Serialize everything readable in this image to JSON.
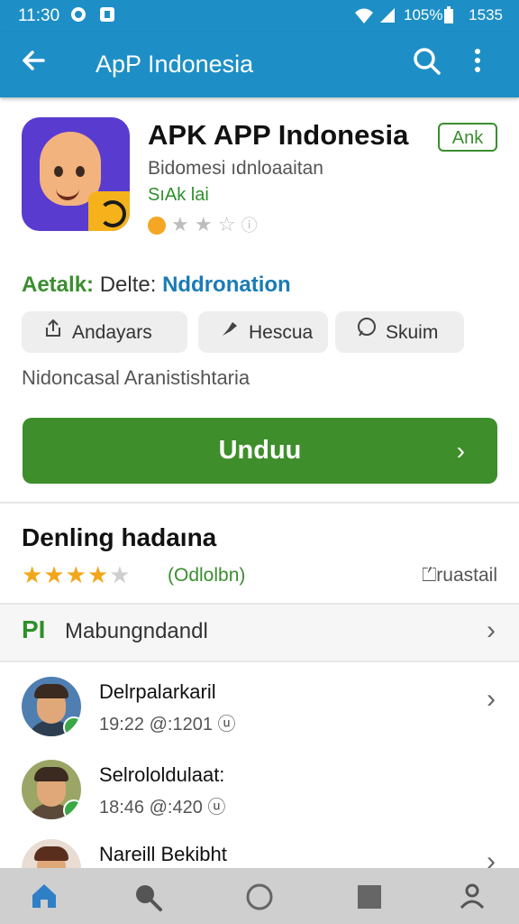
{
  "status_bar": {
    "time": "11:30",
    "battery": "105%",
    "clock_right": "1535"
  },
  "app_bar": {
    "title": "ApP Indonesia"
  },
  "app": {
    "title": "APK APP Indonesia",
    "install_chip": "Ank",
    "subtitle": "Bidomesi ıdnloaaitan",
    "developer": "SıAk lai",
    "meta_key": "Aetalk:",
    "meta_mid": " Delte: ",
    "meta_value": "Nddronation",
    "chips": [
      {
        "label": "Andayars",
        "icon": "share-icon"
      },
      {
        "label": "Hescua",
        "icon": "pin-icon"
      },
      {
        "label": "Skuim",
        "icon": "chat-icon"
      }
    ],
    "category": "Nidoncasal Aranistishtaria",
    "download_label": "Unduu",
    "download_chevron": "›"
  },
  "reviews_section": {
    "title": "Denling hadaına",
    "rating_stars": 4,
    "rating_count": "(Odlolbn)",
    "right_label": "ruastail",
    "row_logo": "PI",
    "row_label": "Mabungndandl",
    "items": [
      {
        "name": "Delrpalarkaril",
        "time": "19:22 @:1201 ⓤ"
      },
      {
        "name": "Selrololdulaat:",
        "time": "18:46 @:420 ⓤ"
      },
      {
        "name": "Nareill Bekibht",
        "time": ""
      }
    ]
  },
  "colors": {
    "primary": "#1e8fc6",
    "accent_green": "#3e8e2b",
    "link_blue": "#1a7bb5",
    "star": "#f2a61a"
  },
  "nav_icons": [
    "home-icon",
    "search-icon",
    "circle-icon",
    "square-icon",
    "account-icon"
  ]
}
